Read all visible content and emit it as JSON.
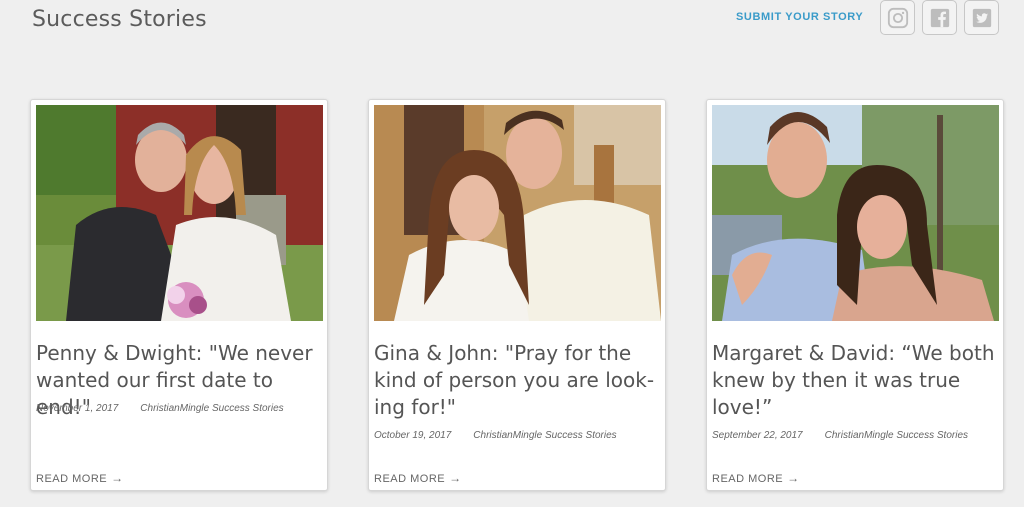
{
  "header": {
    "title": "Success Stories",
    "submit_label": "SUBMIT YOUR STORY"
  },
  "social": {
    "icons": [
      "instagram-icon",
      "facebook-icon",
      "twitter-icon"
    ]
  },
  "cards": [
    {
      "title": "Penny & Dwight: \"We never wanted our first date to end!\"",
      "date": "November 1, 2017",
      "category": "ChristianMingle Success Stories",
      "read_more": "READ MORE"
    },
    {
      "title": "Gina & John: \"Pray for the kind of person you are look-ing for!\"",
      "date": "October 19, 2017",
      "category": "ChristianMingle Success Stories",
      "read_more": "READ MORE"
    },
    {
      "title": "Margaret & David: “We both knew by then it was true love!”",
      "date": "September 22, 2017",
      "category": "ChristianMingle Success Stories",
      "read_more": "READ MORE"
    }
  ],
  "colors": {
    "background": "#efefef",
    "accent_link": "#3a9bc9",
    "text": "#555555"
  }
}
